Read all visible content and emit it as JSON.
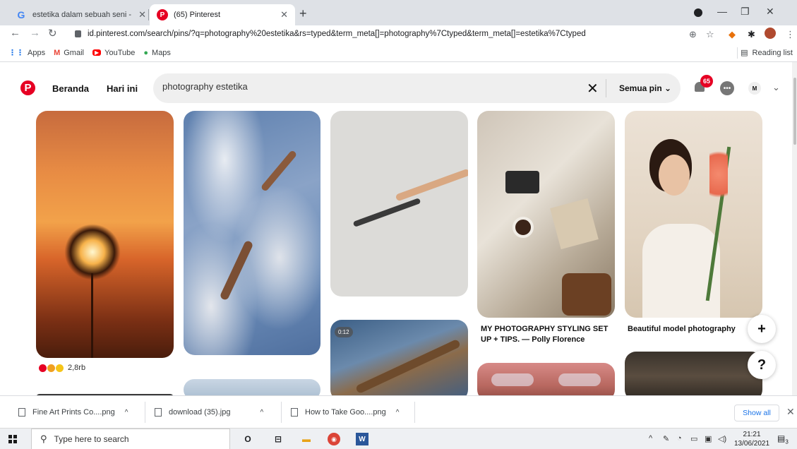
{
  "browser": {
    "tabs": [
      {
        "title": "estetika dalam sebuah seni - Pen",
        "favicon": "G"
      },
      {
        "title": "(65) Pinterest",
        "favicon": "P"
      }
    ],
    "url": "id.pinterest.com/search/pins/?q=photography%20estetika&rs=typed&term_meta[]=photography%7Ctyped&term_meta[]=estetika%7Ctyped",
    "bookmarks": [
      "Apps",
      "Gmail",
      "YouTube",
      "Maps"
    ],
    "reading_list": "Reading list"
  },
  "pinterest": {
    "nav": {
      "home": "Beranda",
      "today": "Hari ini"
    },
    "search": {
      "value": "photography estetika",
      "filter": "Semua pin"
    },
    "notification_count": "65",
    "avatar_initial": "M",
    "pins": [
      {
        "caption": "",
        "reactions": "2,8rb"
      },
      {
        "caption": ""
      },
      {
        "caption": ""
      },
      {
        "caption": "MY PHOTOGRAPHY STYLING SET UP + TIPS. — Polly Florence"
      },
      {
        "caption": "Beautiful model photography"
      }
    ],
    "video_duration": "0:12",
    "fab_add": "+",
    "fab_help": "?"
  },
  "downloads": {
    "items": [
      "Fine Art Prints Co....png",
      "download (35).jpg",
      "How to Take Goo....png"
    ],
    "show_all": "Show all"
  },
  "taskbar": {
    "search_placeholder": "Type here to search",
    "time": "21:21",
    "date": "13/06/2021",
    "notifications": "3"
  },
  "colors": {
    "pinterest_red": "#e60023",
    "link_blue": "#1a73e8"
  }
}
